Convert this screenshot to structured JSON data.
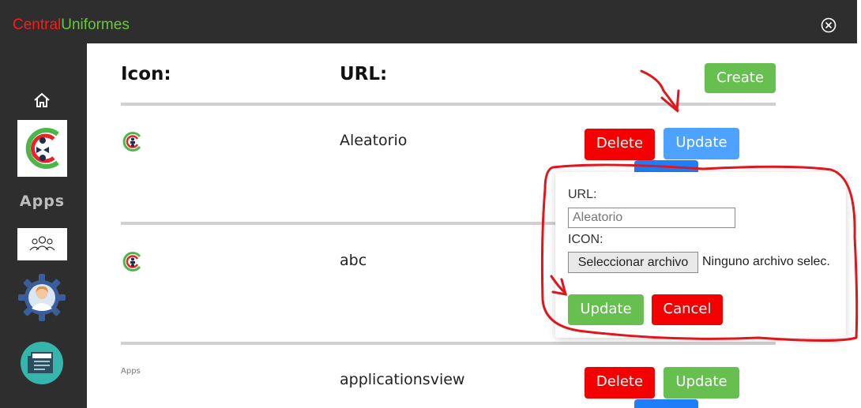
{
  "header": {
    "brand_part1": "Central",
    "brand_part2": "Uniformes",
    "close_icon": "close-circle-icon",
    "brand_colors": {
      "part1": "#ff1a1a",
      "part2": "#66cc33"
    }
  },
  "sidebar": {
    "items": [
      {
        "icon": "home-icon"
      },
      {
        "icon": "company-logo-icon"
      },
      {
        "icon": "apps-icon",
        "label": "Apps"
      },
      {
        "icon": "team-icon"
      },
      {
        "icon": "user-settings-gear-icon"
      },
      {
        "icon": "news-icon"
      }
    ]
  },
  "table": {
    "headers": {
      "icon": "Icon:",
      "url": "URL:"
    },
    "create_label": "Create",
    "rows": [
      {
        "icon": "company-logo-icon",
        "url": "Aleatorio",
        "delete_label": "Delete",
        "update_label": "Update"
      },
      {
        "icon": "company-logo-icon",
        "url": "abc"
      },
      {
        "icon": "apps-icon",
        "icon_text": "Apps",
        "url": "applicationsview",
        "delete_label": "Delete",
        "update_label": "Update"
      }
    ]
  },
  "popup": {
    "url_label": "URL:",
    "url_value": "",
    "url_placeholder": "Aleatorio",
    "icon_label": "ICON:",
    "file_button_label": "Seleccionar archivo",
    "file_status": "Ninguno archivo selec.",
    "update_label": "Update",
    "cancel_label": "Cancel"
  },
  "colors": {
    "green": "#66bf4f",
    "red": "#f50000",
    "blue": "#4da3ff",
    "dark": "#2e2e2e",
    "annotation": "#e0161c"
  }
}
